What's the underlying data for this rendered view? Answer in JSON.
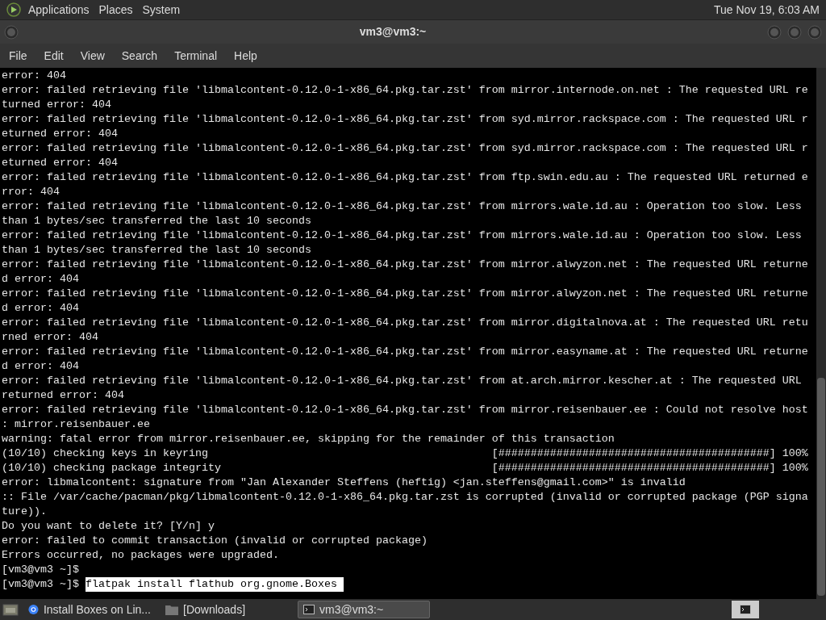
{
  "top_panel": {
    "menus": [
      "Applications",
      "Places",
      "System"
    ],
    "clock": "Tue Nov 19, 6:03 AM"
  },
  "window": {
    "title": "vm3@vm3:~"
  },
  "menu_bar": [
    "File",
    "Edit",
    "View",
    "Search",
    "Terminal",
    "Help"
  ],
  "terminal": {
    "lines": [
      {
        "kind": "output",
        "text": "error: 404"
      },
      {
        "kind": "output",
        "text": "error: failed retrieving file 'libmalcontent-0.12.0-1-x86_64.pkg.tar.zst' from mirror.internode.on.net : The requested URL re"
      },
      {
        "kind": "output",
        "text": "turned error: 404"
      },
      {
        "kind": "output",
        "text": "error: failed retrieving file 'libmalcontent-0.12.0-1-x86_64.pkg.tar.zst' from syd.mirror.rackspace.com : The requested URL r"
      },
      {
        "kind": "output",
        "text": "eturned error: 404"
      },
      {
        "kind": "output",
        "text": "error: failed retrieving file 'libmalcontent-0.12.0-1-x86_64.pkg.tar.zst' from syd.mirror.rackspace.com : The requested URL r"
      },
      {
        "kind": "output",
        "text": "eturned error: 404"
      },
      {
        "kind": "output",
        "text": "error: failed retrieving file 'libmalcontent-0.12.0-1-x86_64.pkg.tar.zst' from ftp.swin.edu.au : The requested URL returned e"
      },
      {
        "kind": "output",
        "text": "rror: 404"
      },
      {
        "kind": "output",
        "text": "error: failed retrieving file 'libmalcontent-0.12.0-1-x86_64.pkg.tar.zst' from mirrors.wale.id.au : Operation too slow. Less"
      },
      {
        "kind": "output",
        "text": "than 1 bytes/sec transferred the last 10 seconds"
      },
      {
        "kind": "output",
        "text": "error: failed retrieving file 'libmalcontent-0.12.0-1-x86_64.pkg.tar.zst' from mirrors.wale.id.au : Operation too slow. Less"
      },
      {
        "kind": "output",
        "text": "than 1 bytes/sec transferred the last 10 seconds"
      },
      {
        "kind": "output",
        "text": "error: failed retrieving file 'libmalcontent-0.12.0-1-x86_64.pkg.tar.zst' from mirror.alwyzon.net : The requested URL returne"
      },
      {
        "kind": "output",
        "text": "d error: 404"
      },
      {
        "kind": "output",
        "text": "error: failed retrieving file 'libmalcontent-0.12.0-1-x86_64.pkg.tar.zst' from mirror.alwyzon.net : The requested URL returne"
      },
      {
        "kind": "output",
        "text": "d error: 404"
      },
      {
        "kind": "output",
        "text": "error: failed retrieving file 'libmalcontent-0.12.0-1-x86_64.pkg.tar.zst' from mirror.digitalnova.at : The requested URL retu"
      },
      {
        "kind": "output",
        "text": "rned error: 404"
      },
      {
        "kind": "output",
        "text": "error: failed retrieving file 'libmalcontent-0.12.0-1-x86_64.pkg.tar.zst' from mirror.easyname.at : The requested URL returne"
      },
      {
        "kind": "output",
        "text": "d error: 404"
      },
      {
        "kind": "output",
        "text": "error: failed retrieving file 'libmalcontent-0.12.0-1-x86_64.pkg.tar.zst' from at.arch.mirror.kescher.at : The requested URL"
      },
      {
        "kind": "output",
        "text": "returned error: 404"
      },
      {
        "kind": "output",
        "text": "error: failed retrieving file 'libmalcontent-0.12.0-1-x86_64.pkg.tar.zst' from mirror.reisenbauer.ee : Could not resolve host"
      },
      {
        "kind": "output",
        "text": ": mirror.reisenbauer.ee"
      },
      {
        "kind": "output",
        "text": "warning: fatal error from mirror.reisenbauer.ee, skipping for the remainder of this transaction"
      },
      {
        "kind": "output",
        "text": "(10/10) checking keys in keyring                                            [##########################################] 100%"
      },
      {
        "kind": "output",
        "text": "(10/10) checking package integrity                                          [##########################################] 100%"
      },
      {
        "kind": "output",
        "text": "error: libmalcontent: signature from \"Jan Alexander Steffens (heftig) <jan.steffens@gmail.com>\" is invalid"
      },
      {
        "kind": "output",
        "text": ":: File /var/cache/pacman/pkg/libmalcontent-0.12.0-1-x86_64.pkg.tar.zst is corrupted (invalid or corrupted package (PGP signa"
      },
      {
        "kind": "output",
        "text": "ture))."
      },
      {
        "kind": "output",
        "text": "Do you want to delete it? [Y/n] y"
      },
      {
        "kind": "output",
        "text": "error: failed to commit transaction (invalid or corrupted package)"
      },
      {
        "kind": "output",
        "text": "Errors occurred, no packages were upgraded."
      },
      {
        "kind": "prompt",
        "prompt": "[vm3@vm3 ~]$"
      },
      {
        "kind": "prompt",
        "prompt": "[vm3@vm3 ~]$",
        "command": "flatpak install flathub org.gnome.Boxes",
        "highlighted": true
      }
    ]
  },
  "taskbar": {
    "tasks": [
      {
        "kind": "browser",
        "label": "Install Boxes on Lin...",
        "selected": false
      },
      {
        "kind": "folder",
        "label": "[Downloads]",
        "selected": false
      },
      {
        "kind": "terminal",
        "label": "vm3@vm3:~",
        "selected": true
      }
    ]
  }
}
